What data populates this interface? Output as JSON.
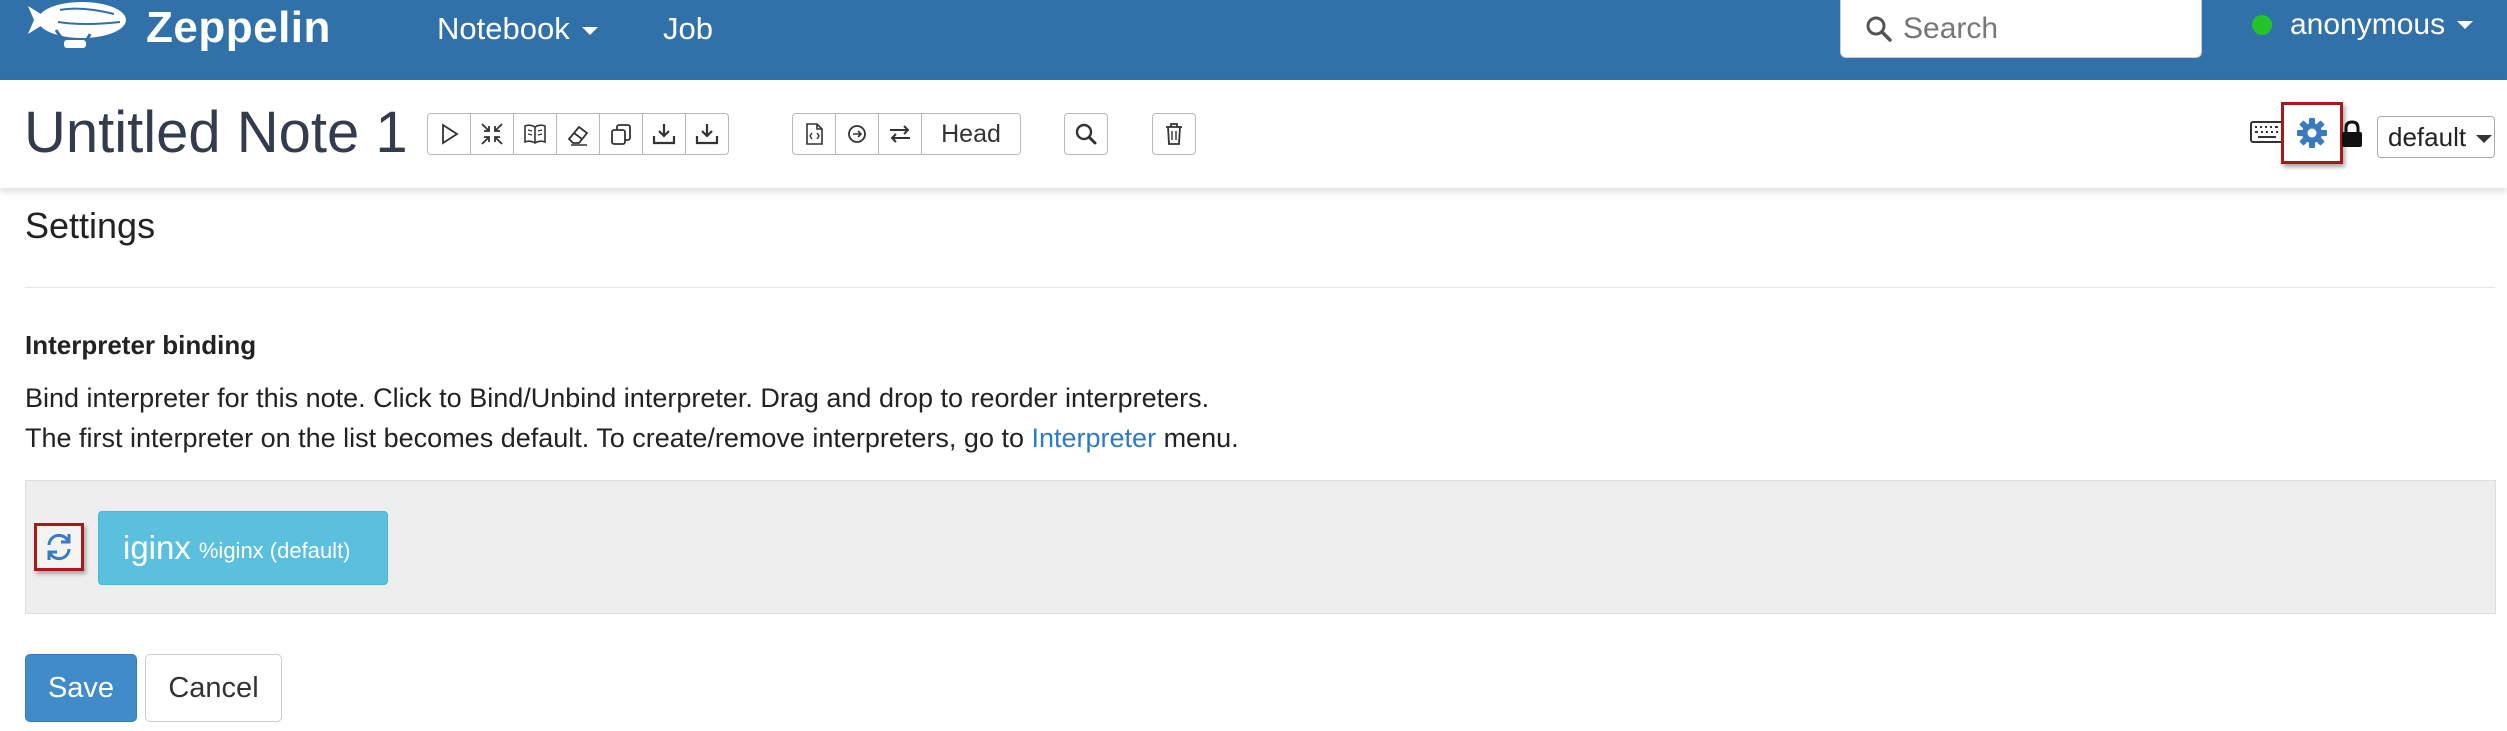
{
  "navbar": {
    "brand": "Zeppelin",
    "menu_notebook": "Notebook",
    "menu_job": "Job",
    "search_placeholder": "Search",
    "username": "anonymous"
  },
  "note": {
    "title": "Untitled Note 1",
    "head_label": "Head",
    "interpreter_select": "default"
  },
  "settings": {
    "title": "Settings",
    "binding_title": "Interpreter binding",
    "description_line1": "Bind interpreter for this note. Click to Bind/Unbind interpreter. Drag and drop to reorder interpreters.",
    "description_line2_prefix": "The first interpreter on the list becomes default. To create/remove interpreters, go to ",
    "description_link": "Interpreter",
    "description_line2_suffix": " menu.",
    "interpreters": [
      {
        "name": "iginx",
        "detail": "%iginx (default)"
      }
    ],
    "save_label": "Save",
    "cancel_label": "Cancel"
  },
  "colors": {
    "navbar": "#3071a9",
    "primary": "#428bca",
    "interpreter_bound": "#5bc0de",
    "link": "#2d7ac7",
    "online": "#22c42a",
    "highlight_border": "#a31b1b"
  },
  "icons": {
    "toolbar": [
      "run-all-icon",
      "collapse-icon",
      "book-icon",
      "eraser-icon",
      "copy-icon",
      "download-icon",
      "export-icon",
      "version-icon",
      "commit-icon",
      "compare-icon",
      "search-icon",
      "trash-icon"
    ],
    "right": [
      "keyboard-icon",
      "gear-icon",
      "lock-icon"
    ],
    "binding": [
      "refresh-icon"
    ]
  }
}
